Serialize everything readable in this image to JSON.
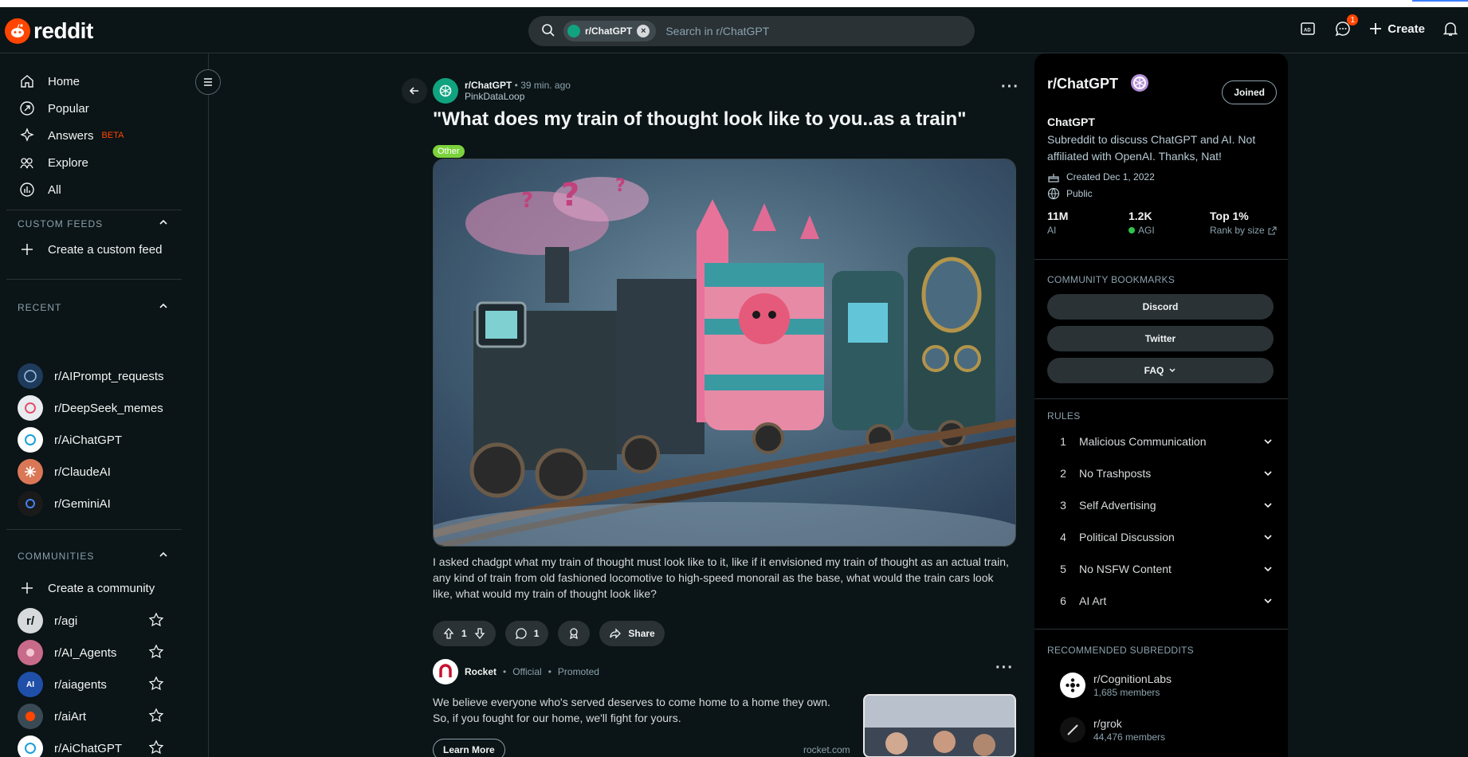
{
  "header": {
    "logo_text": "reddit",
    "search_chip": "r/ChatGPT",
    "search_placeholder": "Search in r/ChatGPT",
    "chat_badge": "1",
    "create_label": "Create"
  },
  "nav": {
    "items": [
      {
        "label": "Home"
      },
      {
        "label": "Popular"
      },
      {
        "label": "Answers",
        "badge": "BETA"
      },
      {
        "label": "Explore"
      },
      {
        "label": "All"
      }
    ],
    "custom_feeds": {
      "title": "CUSTOM FEEDS",
      "create": "Create a custom feed"
    },
    "recent": {
      "title": "RECENT",
      "items": [
        "r/AIPrompt_requests",
        "r/DeepSeek_memes",
        "r/AiChatGPT",
        "r/ClaudeAI",
        "r/GeminiAI"
      ]
    },
    "communities": {
      "title": "COMMUNITIES",
      "create": "Create a community",
      "items": [
        "r/agi",
        "r/AI_Agents",
        "r/aiagents",
        "r/aiArt",
        "r/AiChatGPT"
      ]
    }
  },
  "post": {
    "subreddit": "r/ChatGPT",
    "time": "39 min. ago",
    "author": "PinkDataLoop",
    "title": "\"What does my train of thought look like to you..as a train\"",
    "flair": "Other",
    "body": "I asked chadgpt what my train of thought must look like to it, like if it envisioned my train of thought as an actual train, any kind of train from old fashioned locomotive to high-speed monorail as the base, what would the train cars look like, what would my train of thought look like?",
    "upvotes": "1",
    "comments": "1",
    "share_label": "Share"
  },
  "promo": {
    "name": "Rocket",
    "official": "Official",
    "promoted": "Promoted",
    "text": "We believe everyone who's served deserves to come home to a home they own. So, if you fought for our home, we'll fight for yours.",
    "cta": "Learn More",
    "domain": "rocket.com"
  },
  "sidebar": {
    "name": "r/ChatGPT",
    "joined_label": "Joined",
    "title": "ChatGPT",
    "description": "Subreddit to discuss ChatGPT and AI. Not affiliated with OpenAI. Thanks, Nat!",
    "created": "Created Dec 1, 2022",
    "visibility": "Public",
    "stats": [
      {
        "value": "11M",
        "label": "AI"
      },
      {
        "value": "1.2K",
        "label": "AGI"
      },
      {
        "value": "Top 1%",
        "label": "Rank by size"
      }
    ],
    "bookmarks_title": "COMMUNITY BOOKMARKS",
    "bookmarks": [
      "Discord",
      "Twitter",
      "FAQ"
    ],
    "rules_title": "RULES",
    "rules": [
      {
        "num": "1",
        "text": "Malicious Communication"
      },
      {
        "num": "2",
        "text": "No Trashposts"
      },
      {
        "num": "3",
        "text": "Self Advertising"
      },
      {
        "num": "4",
        "text": "Political Discussion"
      },
      {
        "num": "5",
        "text": "No NSFW Content"
      },
      {
        "num": "6",
        "text": "AI Art"
      }
    ],
    "recommended_title": "RECOMMENDED SUBREDDITS",
    "recommended": [
      {
        "name": "r/CognitionLabs",
        "members": "1,685 members"
      },
      {
        "name": "r/grok",
        "members": "44,476 members"
      }
    ]
  },
  "colors": {
    "accent": "#ff4500",
    "online": "#2ec44b",
    "flair": "#7bd23c"
  }
}
